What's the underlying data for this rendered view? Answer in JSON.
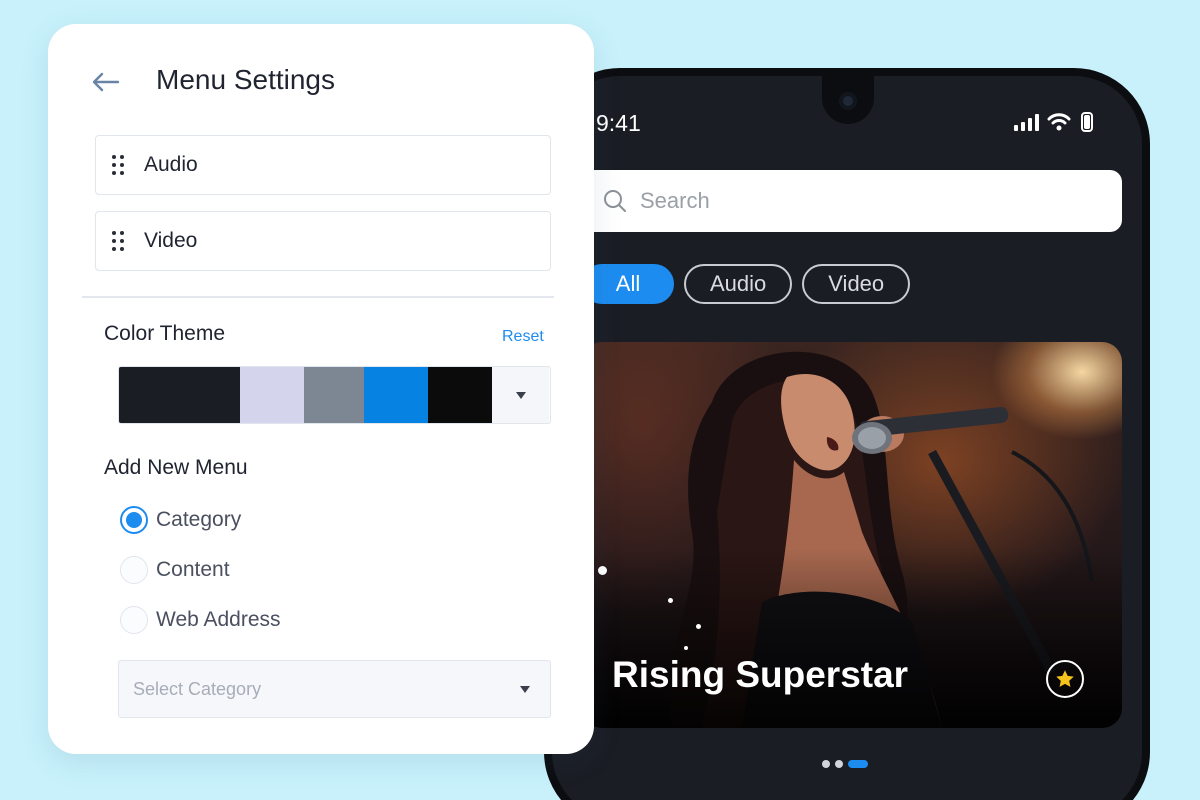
{
  "settings": {
    "title": "Menu Settings",
    "menu_items": [
      {
        "label": "Audio",
        "icon": "drag-handle-icon"
      },
      {
        "label": "Video",
        "icon": "drag-handle-icon"
      }
    ],
    "color_theme": {
      "title": "Color Theme",
      "reset_label": "Reset",
      "swatches": [
        "#1b1d24",
        "#d4d4ec",
        "#7c8793",
        "#0683e2",
        "#0b0b0b"
      ]
    },
    "add_menu": {
      "title": "Add New Menu",
      "options": [
        {
          "label": "Category",
          "checked": true
        },
        {
          "label": "Content",
          "checked": false
        },
        {
          "label": "Web Address",
          "checked": false
        }
      ],
      "select_placeholder": "Select Category"
    }
  },
  "phone": {
    "status_time": "9:41",
    "search_placeholder": "Search",
    "chips": [
      {
        "label": "All",
        "active": true
      },
      {
        "label": "Audio",
        "active": false
      },
      {
        "label": "Video",
        "active": false
      }
    ],
    "hero_title": "Rising Superstar",
    "carousel": {
      "total": 3,
      "active_index": 2
    }
  },
  "colors": {
    "accent": "#1d8cf0",
    "background": "#c8f1fb",
    "phone_screen": "#1b1d24"
  }
}
